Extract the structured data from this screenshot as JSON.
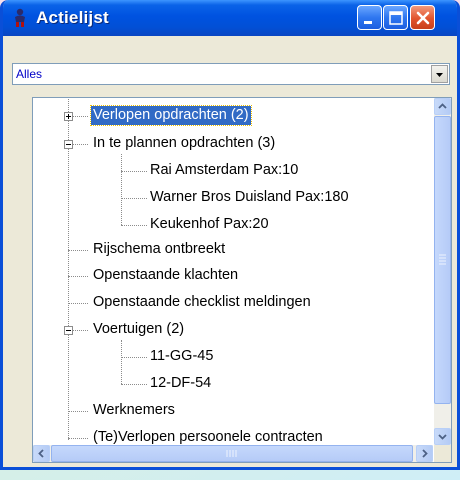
{
  "window": {
    "title": "Actielijst",
    "controls": {
      "minimize": "minimize-icon",
      "maximize": "maximize-icon",
      "close": "close-icon"
    }
  },
  "filter": {
    "selected": "Alles"
  },
  "tree": {
    "nodes": [
      {
        "label": "Verlopen opdrachten (2)",
        "selected": true,
        "expander": "plus"
      },
      {
        "label": "In te plannen opdrachten (3)",
        "expander": "minus"
      },
      {
        "label": "Rai Amsterdam Pax:10"
      },
      {
        "label": "Warner Bros Duisland Pax:180"
      },
      {
        "label": "Keukenhof Pax:20"
      },
      {
        "label": "Rijschema ontbreekt"
      },
      {
        "label": "Openstaande klachten"
      },
      {
        "label": "Openstaande checklist meldingen"
      },
      {
        "label": "Voertuigen (2)",
        "expander": "minus"
      },
      {
        "label": "11-GG-45"
      },
      {
        "label": "12-DF-54"
      },
      {
        "label": "Werknemers"
      },
      {
        "label": "(Te)Verlopen persoonele contracten"
      }
    ]
  },
  "colors": {
    "titlebar": "#0052e0",
    "selection": "#316ac5",
    "combo_text": "#0000c8"
  }
}
